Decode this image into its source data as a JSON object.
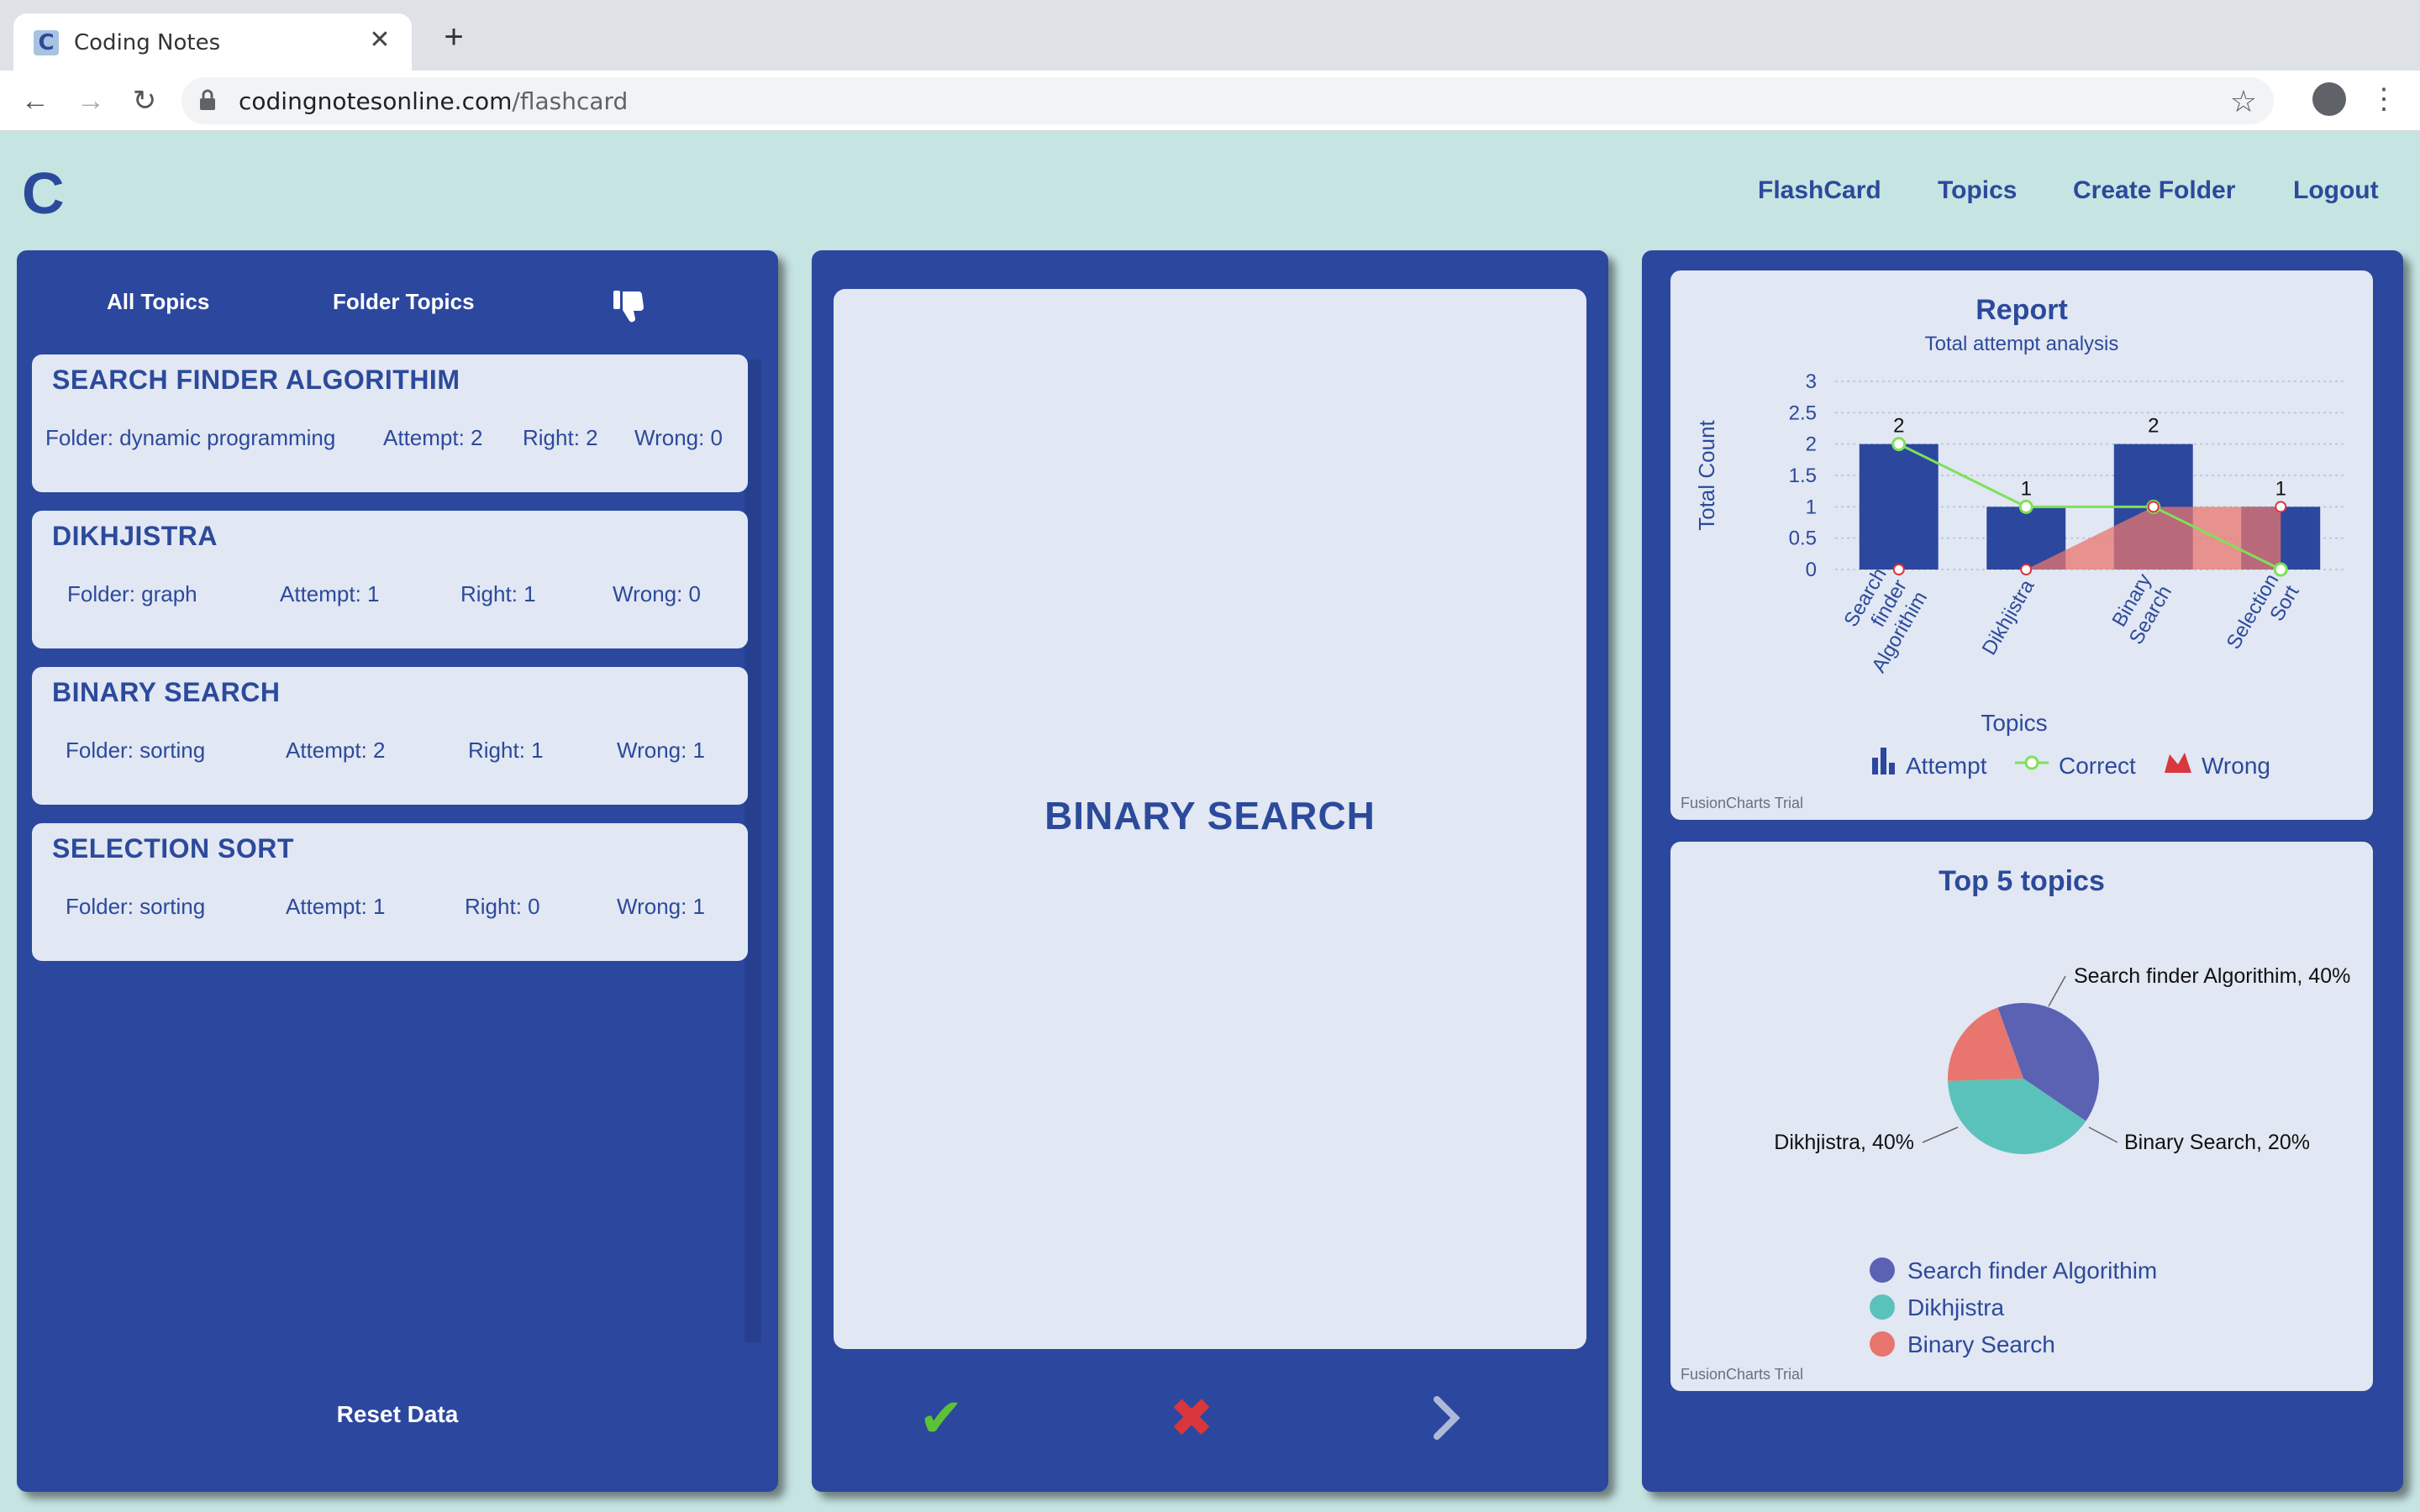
{
  "browser": {
    "tab_title": "Coding Notes",
    "favicon_letter": "C",
    "url_host": "codingnotesonline.com",
    "url_path": "/flashcard"
  },
  "header": {
    "logo": "C",
    "nav": [
      "FlashCard",
      "Topics",
      "Create Folder",
      "Logout"
    ]
  },
  "left_panel": {
    "tabs": [
      "All Topics",
      "Folder Topics"
    ],
    "topics": [
      {
        "title": "SEARCH FINDER ALGORITHIM",
        "folder": "Folder: dynamic programming",
        "attempt": "Attempt: 2",
        "right": "Right: 2",
        "wrong": "Wrong: 0"
      },
      {
        "title": "DIKHJISTRA",
        "folder": "Folder: graph",
        "attempt": "Attempt: 1",
        "right": "Right: 1",
        "wrong": "Wrong: 0"
      },
      {
        "title": "BINARY SEARCH",
        "folder": "Folder: sorting",
        "attempt": "Attempt: 2",
        "right": "Right: 1",
        "wrong": "Wrong: 1"
      },
      {
        "title": "SELECTION SORT",
        "folder": "Folder: sorting",
        "attempt": "Attempt: 1",
        "right": "Right: 0",
        "wrong": "Wrong: 1"
      }
    ],
    "reset_label": "Reset Data"
  },
  "flashcard": {
    "text": "BINARY SEARCH"
  },
  "colors": {
    "primary": "#2c479e",
    "card_bg": "#e1e7f3",
    "correct": "#5bc236",
    "wrong": "#d9363e",
    "attempt_bar": "#2c479e",
    "correct_line": "#7fe05a",
    "wrong_area": "#e8756e"
  },
  "chart_data": [
    {
      "type": "bar",
      "title": "Report",
      "subtitle": "Total attempt analysis",
      "xlabel": "Topics",
      "ylabel": "Total Count",
      "ylim": [
        0,
        3
      ],
      "yticks": [
        "0",
        "0.5",
        "1",
        "1.5",
        "2",
        "2.5",
        "3"
      ],
      "categories": [
        "Search finder Algorithim",
        "Dikhjistra",
        "Binary Search",
        "Selection Sort"
      ],
      "series": [
        {
          "name": "Attempt",
          "kind": "bar",
          "values": [
            2,
            1,
            2,
            1
          ]
        },
        {
          "name": "Correct",
          "kind": "line",
          "values": [
            2,
            1,
            1,
            0
          ]
        },
        {
          "name": "Wrong",
          "kind": "area",
          "values": [
            0,
            0,
            1,
            1
          ]
        }
      ],
      "data_labels": [
        "2",
        "1",
        "2",
        "1"
      ],
      "legend_position": "bottom",
      "watermark": "FusionCharts Trial"
    },
    {
      "type": "pie",
      "title": "Top 5 topics",
      "slices": [
        {
          "label": "Search finder Algorithim",
          "value": 40,
          "display": "Search finder Algorithim, 40%",
          "color": "#5b62b4"
        },
        {
          "label": "Dikhjistra",
          "value": 40,
          "display": "Dikhjistra, 40%",
          "color": "#5bc2bb"
        },
        {
          "label": "Binary Search",
          "value": 20,
          "display": "Binary Search, 20%",
          "color": "#e8756e"
        }
      ],
      "legend_position": "bottom",
      "watermark": "FusionCharts Trial"
    }
  ]
}
